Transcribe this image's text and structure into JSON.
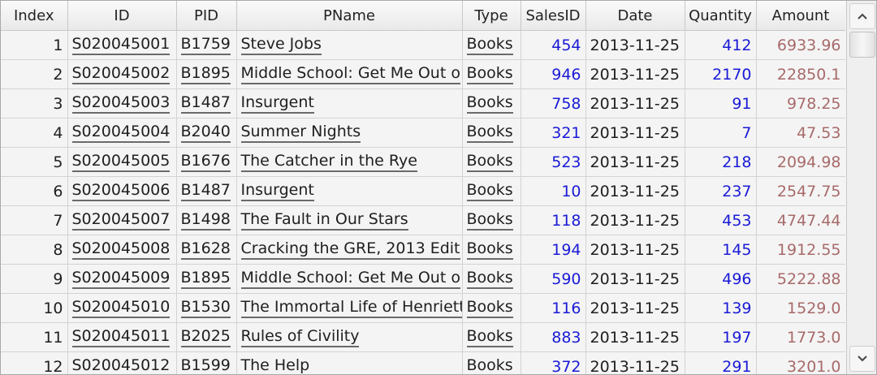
{
  "table": {
    "columns": [
      "Index",
      "ID",
      "PID",
      "PName",
      "Type",
      "SalesID",
      "Date",
      "Quantity",
      "Amount"
    ],
    "rows": [
      [
        "1",
        "S020045001",
        "B1759",
        "Steve Jobs",
        "Books",
        "454",
        "2013-11-25",
        "412",
        "6933.96"
      ],
      [
        "2",
        "S020045002",
        "B1895",
        "Middle School: Get Me Out o",
        "Books",
        "946",
        "2013-11-25",
        "2170",
        "22850.1"
      ],
      [
        "3",
        "S020045003",
        "B1487",
        "Insurgent",
        "Books",
        "758",
        "2013-11-25",
        "91",
        "978.25"
      ],
      [
        "4",
        "S020045004",
        "B2040",
        "Summer Nights",
        "Books",
        "321",
        "2013-11-25",
        "7",
        "47.53"
      ],
      [
        "5",
        "S020045005",
        "B1676",
        "The Catcher in the Rye",
        "Books",
        "523",
        "2013-11-25",
        "218",
        "2094.98"
      ],
      [
        "6",
        "S020045006",
        "B1487",
        "Insurgent",
        "Books",
        "10",
        "2013-11-25",
        "237",
        "2547.75"
      ],
      [
        "7",
        "S020045007",
        "B1498",
        "The Fault in Our Stars",
        "Books",
        "118",
        "2013-11-25",
        "453",
        "4747.44"
      ],
      [
        "8",
        "S020045008",
        "B1628",
        "Cracking the GRE, 2013 Edit",
        "Books",
        "194",
        "2013-11-25",
        "145",
        "1912.55"
      ],
      [
        "9",
        "S020045009",
        "B1895",
        "Middle School: Get Me Out o",
        "Books",
        "590",
        "2013-11-25",
        "496",
        "5222.88"
      ],
      [
        "10",
        "S020045010",
        "B1530",
        "The Immortal Life of Henriett",
        "Books",
        "116",
        "2013-11-25",
        "139",
        "1529.0"
      ],
      [
        "11",
        "S020045011",
        "B2025",
        "Rules of Civility",
        "Books",
        "883",
        "2013-11-25",
        "197",
        "1773.0"
      ],
      [
        "12",
        "S020045012",
        "B1599",
        "The Help",
        "Books",
        "372",
        "2013-11-25",
        "291",
        "3201.0"
      ]
    ]
  },
  "scrollbar": {
    "up_icon": "chevron-up-icon",
    "down_icon": "chevron-down-icon"
  },
  "colors": {
    "number_blue": "#1a1ad6",
    "amount_red": "#a86a6a",
    "header_bg": "#ececec",
    "cell_bg": "#f4f4f4"
  }
}
